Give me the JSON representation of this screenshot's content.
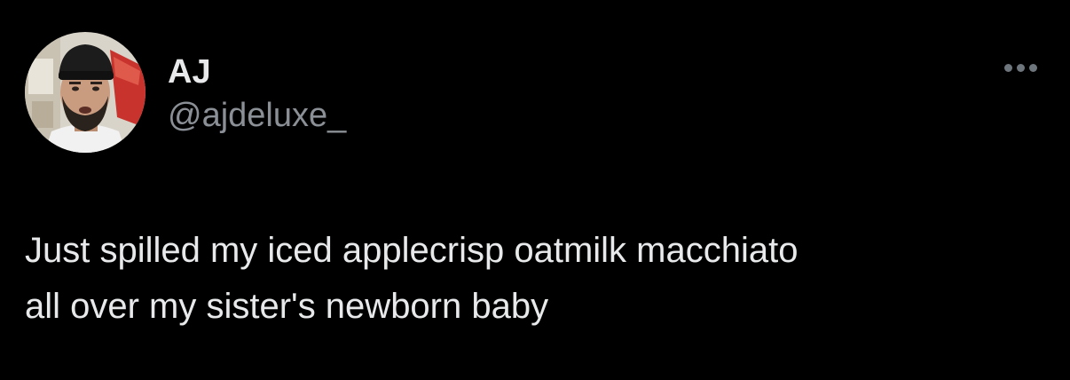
{
  "tweet": {
    "author": {
      "display_name": "AJ",
      "handle": "@ajdeluxe_",
      "avatar_icon": "user-avatar-photo"
    },
    "more_icon": "ellipsis-icon",
    "text": "Just spilled my iced applecrisp oatmilk macchiato\nall over my sister's newborn baby"
  },
  "colors": {
    "background": "#000000",
    "primary_text": "#e7e9ea",
    "secondary_text": "#8b9096",
    "icon": "#6e767d"
  }
}
